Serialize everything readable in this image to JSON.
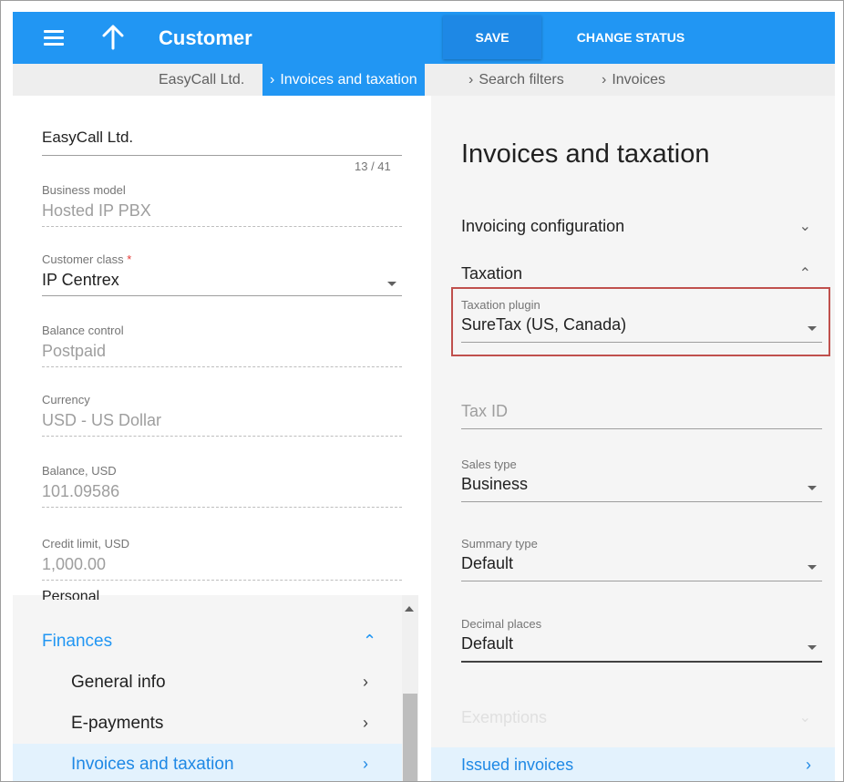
{
  "header": {
    "title": "Customer",
    "save_label": "SAVE",
    "change_status_label": "CHANGE STATUS"
  },
  "breadcrumb": {
    "items": [
      "EasyCall Ltd.",
      "Invoices and taxation",
      "Search filters",
      "Invoices"
    ]
  },
  "left": {
    "customer_name": "EasyCall Ltd.",
    "char_counter": "13 / 41",
    "business_model": {
      "label": "Business model",
      "value": "Hosted IP PBX"
    },
    "customer_class": {
      "label": "Customer class",
      "required": "*",
      "value": "IP Centrex"
    },
    "balance_control": {
      "label": "Balance control",
      "value": "Postpaid"
    },
    "currency": {
      "label": "Currency",
      "value": "USD - US Dollar"
    },
    "balance": {
      "label": "Balance, USD",
      "value": "101.09586"
    },
    "credit_limit": {
      "label": "Credit limit, USD",
      "value": "1,000.00"
    },
    "cut_off_item": "Personal",
    "nav": [
      {
        "label": "Finances",
        "chevron": "^"
      },
      {
        "label": "General info",
        "chevron": ">"
      },
      {
        "label": "E-payments",
        "chevron": ">"
      },
      {
        "label": "Invoices and taxation",
        "chevron": ">"
      }
    ]
  },
  "right": {
    "title": "Invoices and taxation",
    "invoicing_configuration": "Invoicing configuration",
    "taxation": "Taxation",
    "taxation_plugin": {
      "label": "Taxation plugin",
      "value": "SureTax (US, Canada)"
    },
    "tax_id": {
      "placeholder": "Tax ID"
    },
    "sales_type": {
      "label": "Sales type",
      "value": "Business"
    },
    "summary_type": {
      "label": "Summary type",
      "value": "Default"
    },
    "decimal_places": {
      "label": "Decimal places",
      "value": "Default"
    },
    "exemptions": "Exemptions",
    "issued_invoices": "Issued invoices"
  },
  "colors": {
    "accent": "#2196f3",
    "highlight_border": "#c0504d",
    "nav_active_bg": "#e3f2fd"
  },
  "icons": [
    "menu-icon",
    "arrow-up-icon",
    "chevron-right-icon",
    "chevron-up-icon",
    "chevron-down-icon",
    "dropdown-caret-icon"
  ]
}
